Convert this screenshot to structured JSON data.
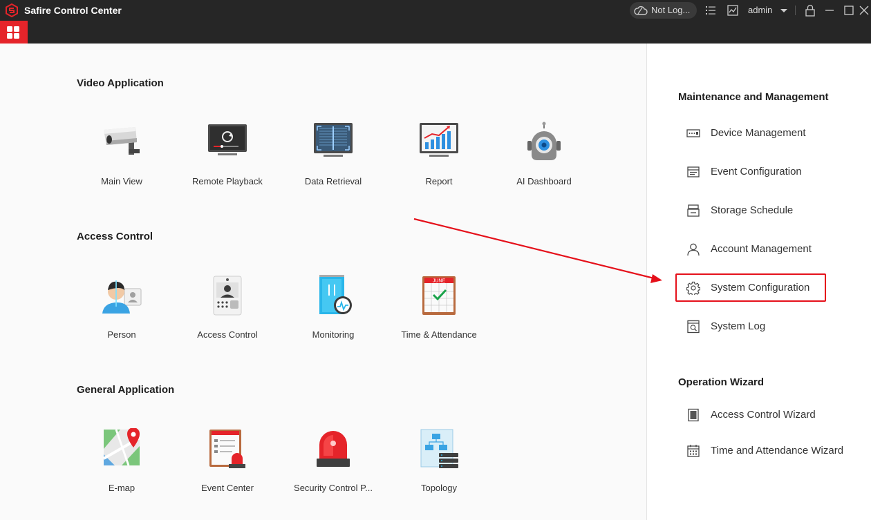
{
  "titlebar": {
    "app_title": "Safire Control Center",
    "login_status": "Not Log...",
    "user": "admin"
  },
  "sections": [
    {
      "title": "Video Application",
      "modules": [
        {
          "label": "Main View",
          "icon": "camera-icon"
        },
        {
          "label": "Remote Playback",
          "icon": "playback-monitor-icon"
        },
        {
          "label": "Data Retrieval",
          "icon": "data-retrieval-icon"
        },
        {
          "label": "Report",
          "icon": "report-chart-icon"
        },
        {
          "label": "AI Dashboard",
          "icon": "ai-robot-icon"
        }
      ]
    },
    {
      "title": "Access Control",
      "modules": [
        {
          "label": "Person",
          "icon": "person-card-icon"
        },
        {
          "label": "Access Control",
          "icon": "door-station-icon"
        },
        {
          "label": "Monitoring",
          "icon": "monitoring-door-icon"
        },
        {
          "label": "Time & Attendance",
          "icon": "calendar-check-icon"
        }
      ]
    },
    {
      "title": "General Application",
      "modules": [
        {
          "label": "E-map",
          "icon": "map-pin-icon"
        },
        {
          "label": "Event Center",
          "icon": "event-alarm-icon"
        },
        {
          "label": "Security Control P...",
          "icon": "siren-icon"
        },
        {
          "label": "Topology",
          "icon": "topology-server-icon"
        }
      ]
    }
  ],
  "sidebar": {
    "maintenance_title": "Maintenance and Management",
    "maintenance_items": [
      {
        "label": "Device Management",
        "icon": "device-icon"
      },
      {
        "label": "Event Configuration",
        "icon": "event-config-icon"
      },
      {
        "label": "Storage Schedule",
        "icon": "storage-icon"
      },
      {
        "label": "Account Management",
        "icon": "account-icon"
      },
      {
        "label": "System Configuration",
        "icon": "gear-icon"
      },
      {
        "label": "System Log",
        "icon": "log-icon"
      }
    ],
    "wizard_title": "Operation Wizard",
    "wizard_items": [
      {
        "label": "Access Control Wizard",
        "icon": "door-icon"
      },
      {
        "label": "Time and Attendance Wizard",
        "icon": "calendar-icon"
      }
    ]
  },
  "calendar_month": "JUNE",
  "colors": {
    "brand_red": "#e5242a",
    "titlebar_bg": "#262626",
    "annotation_red": "#e5101a"
  }
}
